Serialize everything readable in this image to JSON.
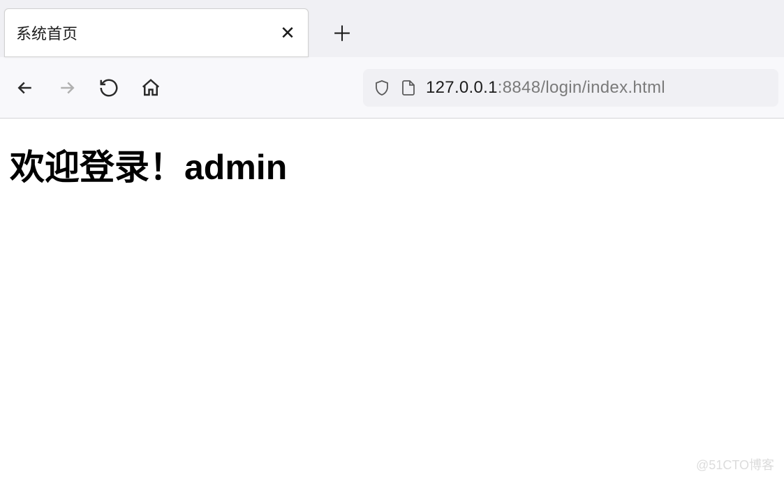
{
  "tab": {
    "title": "系统首页",
    "close_label": "✕"
  },
  "toolbar": {
    "new_tab_label": "＋",
    "url_host": "127.0.0.1",
    "url_port_path": ":8848/login/index.html"
  },
  "page": {
    "heading": "欢迎登录！admin"
  },
  "watermark": "@51CTO博客"
}
